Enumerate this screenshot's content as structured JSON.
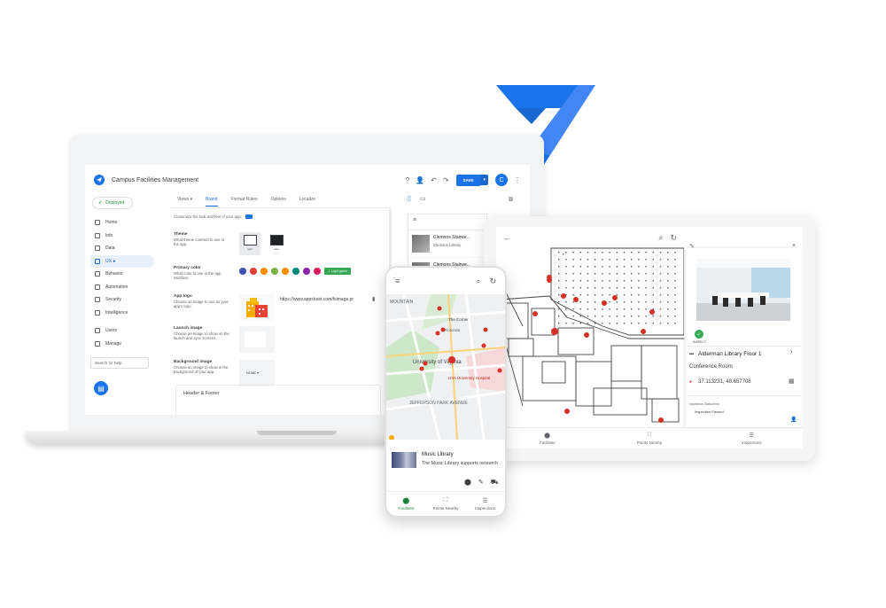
{
  "laptop": {
    "app_title": "Campus Facilities Management",
    "save_label": "SAVE",
    "avatar_letter": "C",
    "deployed_label": "Deployed",
    "sidebar": [
      {
        "label": "Home",
        "icon": "home-icon"
      },
      {
        "label": "Info",
        "icon": "info-icon"
      },
      {
        "label": "Data",
        "icon": "data-icon"
      },
      {
        "label": "UX ●",
        "icon": "ux-icon",
        "active": true
      },
      {
        "label": "Behavior",
        "icon": "behavior-icon"
      },
      {
        "label": "Automation",
        "icon": "automation-icon"
      },
      {
        "label": "Security",
        "icon": "security-icon"
      },
      {
        "label": "Intelligence",
        "icon": "intelligence-icon"
      },
      {
        "label": "Users",
        "icon": "users-icon"
      },
      {
        "label": "Manage",
        "icon": "manage-icon"
      }
    ],
    "search_placeholder": "Search for help",
    "tabs": [
      "Views ▾",
      "Brand",
      "Format Rules",
      "Options",
      "Localize"
    ],
    "selected_tab": "Brand",
    "brand": {
      "intro": "Customize the look and feel of your app.",
      "theme_label": "Theme",
      "theme_desc": "What theme contrast to use in the app.",
      "theme_light": "light",
      "theme_dark": "dark",
      "primary_label": "Primary color",
      "primary_desc": "What color to use in the app interface.",
      "color_chip": "✓ Light green",
      "swatches": [
        "#3f51b5",
        "#e53935",
        "#fb8c00",
        "#7cb342",
        "#fb8c00",
        "#00897b",
        "#8e24aa",
        "#d81b60"
      ],
      "logo_label": "App logo",
      "logo_desc": "Choose an image to use as your app's logo.",
      "logo_url": "https://www.appsheet.com/fsimage.pr",
      "launch_label": "Launch image",
      "launch_desc": "Choose an image to show on the launch and sync screens.",
      "bg_label": "Background image",
      "bg_desc": "Choose an image to show in the background of your app.",
      "bg_value": "NONE ▾",
      "header_footer": "Header & Footer"
    },
    "preview_list": [
      {
        "title": "Clemons Stairwe...",
        "subtitle": "Clemons Library"
      },
      {
        "title": "Clemons Stairwe...",
        "subtitle": ""
      }
    ]
  },
  "tablet": {
    "detail_title": "Alderman Library Floor 1",
    "detail_subtitle": "Conference Room",
    "coordinates": "37.113231, 48.657708",
    "inspect_label": "INSPECT",
    "last_inspection_label": "Inspection Passed",
    "small_label": "Inspection-Status/Info",
    "nav": [
      "Facilities",
      "Points Nearby",
      "Inspections"
    ]
  },
  "phone": {
    "map_labels": {
      "university": "University of Virginia",
      "hospital": "UVA University Hospital",
      "jefferson": "JEFFERSON PARK AVENUE",
      "mountain": "MOUNTAIN",
      "rotunda": "Rotunda",
      "corner": "The Corner"
    },
    "card_title": "Music Library",
    "card_desc": "The Music Library supports research",
    "nav": [
      "Facilities",
      "Points Nearby",
      "Inspections"
    ]
  },
  "colors": {
    "brand_blue": "#1a73e8",
    "accent_green": "#34a853",
    "pin_red": "#d93025"
  }
}
